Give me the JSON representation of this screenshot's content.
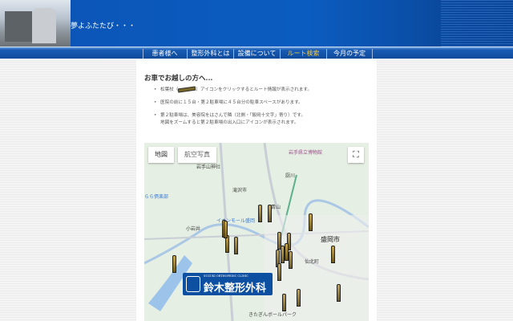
{
  "header": {
    "tagline": "夢よふたたび・・・"
  },
  "nav": [
    {
      "label": "患者様へ"
    },
    {
      "label": "整形外科とは"
    },
    {
      "label": "設備について"
    },
    {
      "label": "ルート検索",
      "active": true
    },
    {
      "label": "今月の予定"
    }
  ],
  "content": {
    "heading": "お車でお越しの方へ...",
    "items": [
      {
        "before": "松葉杖（",
        "after": "）アイコンをクリックするとルート情報が表示されます。"
      },
      {
        "text": "医院の前に１５台・第２駐車場に４５台分の駐車スペースがあります。"
      },
      {
        "line1": "第２駐車場は、美容院をはさんで隣（北側・「飯岡十文字」寄り）です。",
        "line2": "地図をズームすると第２駐車場の出入口にアイコンが表示されます。"
      }
    ]
  },
  "map": {
    "tabs": [
      "地図",
      "航空写真"
    ],
    "fullscreen_icon": "⛶",
    "labels": [
      "岩手県立博物館",
      "滝沢市",
      "厨川",
      "青山",
      "盛岡市",
      "仙北町",
      "小岩井",
      "イオンモール盛岡",
      "きたぎんボールパーク",
      "らら倶楽部",
      "岩手山神社"
    ],
    "logo": {
      "en": "SUZUKI ORTHOPEDIC CLINIC",
      "ja": "鈴木整形外科"
    }
  }
}
